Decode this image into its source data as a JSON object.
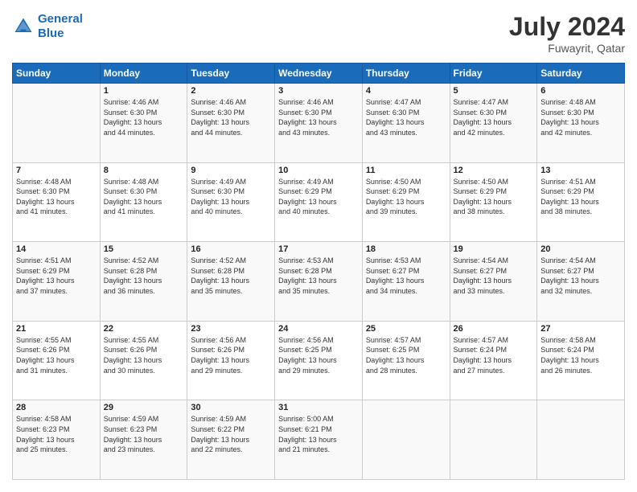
{
  "header": {
    "logo_line1": "General",
    "logo_line2": "Blue",
    "month_year": "July 2024",
    "location": "Fuwayrit, Qatar"
  },
  "days_of_week": [
    "Sunday",
    "Monday",
    "Tuesday",
    "Wednesday",
    "Thursday",
    "Friday",
    "Saturday"
  ],
  "weeks": [
    [
      {
        "day": "",
        "sunrise": "",
        "sunset": "",
        "daylight": ""
      },
      {
        "day": "1",
        "sunrise": "4:46 AM",
        "sunset": "6:30 PM",
        "daylight": "13 hours and 44 minutes."
      },
      {
        "day": "2",
        "sunrise": "4:46 AM",
        "sunset": "6:30 PM",
        "daylight": "13 hours and 44 minutes."
      },
      {
        "day": "3",
        "sunrise": "4:46 AM",
        "sunset": "6:30 PM",
        "daylight": "13 hours and 43 minutes."
      },
      {
        "day": "4",
        "sunrise": "4:47 AM",
        "sunset": "6:30 PM",
        "daylight": "13 hours and 43 minutes."
      },
      {
        "day": "5",
        "sunrise": "4:47 AM",
        "sunset": "6:30 PM",
        "daylight": "13 hours and 42 minutes."
      },
      {
        "day": "6",
        "sunrise": "4:48 AM",
        "sunset": "6:30 PM",
        "daylight": "13 hours and 42 minutes."
      }
    ],
    [
      {
        "day": "7",
        "sunrise": "4:48 AM",
        "sunset": "6:30 PM",
        "daylight": "13 hours and 41 minutes."
      },
      {
        "day": "8",
        "sunrise": "4:48 AM",
        "sunset": "6:30 PM",
        "daylight": "13 hours and 41 minutes."
      },
      {
        "day": "9",
        "sunrise": "4:49 AM",
        "sunset": "6:30 PM",
        "daylight": "13 hours and 40 minutes."
      },
      {
        "day": "10",
        "sunrise": "4:49 AM",
        "sunset": "6:29 PM",
        "daylight": "13 hours and 40 minutes."
      },
      {
        "day": "11",
        "sunrise": "4:50 AM",
        "sunset": "6:29 PM",
        "daylight": "13 hours and 39 minutes."
      },
      {
        "day": "12",
        "sunrise": "4:50 AM",
        "sunset": "6:29 PM",
        "daylight": "13 hours and 38 minutes."
      },
      {
        "day": "13",
        "sunrise": "4:51 AM",
        "sunset": "6:29 PM",
        "daylight": "13 hours and 38 minutes."
      }
    ],
    [
      {
        "day": "14",
        "sunrise": "4:51 AM",
        "sunset": "6:29 PM",
        "daylight": "13 hours and 37 minutes."
      },
      {
        "day": "15",
        "sunrise": "4:52 AM",
        "sunset": "6:28 PM",
        "daylight": "13 hours and 36 minutes."
      },
      {
        "day": "16",
        "sunrise": "4:52 AM",
        "sunset": "6:28 PM",
        "daylight": "13 hours and 35 minutes."
      },
      {
        "day": "17",
        "sunrise": "4:53 AM",
        "sunset": "6:28 PM",
        "daylight": "13 hours and 35 minutes."
      },
      {
        "day": "18",
        "sunrise": "4:53 AM",
        "sunset": "6:27 PM",
        "daylight": "13 hours and 34 minutes."
      },
      {
        "day": "19",
        "sunrise": "4:54 AM",
        "sunset": "6:27 PM",
        "daylight": "13 hours and 33 minutes."
      },
      {
        "day": "20",
        "sunrise": "4:54 AM",
        "sunset": "6:27 PM",
        "daylight": "13 hours and 32 minutes."
      }
    ],
    [
      {
        "day": "21",
        "sunrise": "4:55 AM",
        "sunset": "6:26 PM",
        "daylight": "13 hours and 31 minutes."
      },
      {
        "day": "22",
        "sunrise": "4:55 AM",
        "sunset": "6:26 PM",
        "daylight": "13 hours and 30 minutes."
      },
      {
        "day": "23",
        "sunrise": "4:56 AM",
        "sunset": "6:26 PM",
        "daylight": "13 hours and 29 minutes."
      },
      {
        "day": "24",
        "sunrise": "4:56 AM",
        "sunset": "6:25 PM",
        "daylight": "13 hours and 29 minutes."
      },
      {
        "day": "25",
        "sunrise": "4:57 AM",
        "sunset": "6:25 PM",
        "daylight": "13 hours and 28 minutes."
      },
      {
        "day": "26",
        "sunrise": "4:57 AM",
        "sunset": "6:24 PM",
        "daylight": "13 hours and 27 minutes."
      },
      {
        "day": "27",
        "sunrise": "4:58 AM",
        "sunset": "6:24 PM",
        "daylight": "13 hours and 26 minutes."
      }
    ],
    [
      {
        "day": "28",
        "sunrise": "4:58 AM",
        "sunset": "6:23 PM",
        "daylight": "13 hours and 25 minutes."
      },
      {
        "day": "29",
        "sunrise": "4:59 AM",
        "sunset": "6:23 PM",
        "daylight": "13 hours and 23 minutes."
      },
      {
        "day": "30",
        "sunrise": "4:59 AM",
        "sunset": "6:22 PM",
        "daylight": "13 hours and 22 minutes."
      },
      {
        "day": "31",
        "sunrise": "5:00 AM",
        "sunset": "6:21 PM",
        "daylight": "13 hours and 21 minutes."
      },
      {
        "day": "",
        "sunrise": "",
        "sunset": "",
        "daylight": ""
      },
      {
        "day": "",
        "sunrise": "",
        "sunset": "",
        "daylight": ""
      },
      {
        "day": "",
        "sunrise": "",
        "sunset": "",
        "daylight": ""
      }
    ]
  ],
  "labels": {
    "sunrise_prefix": "Sunrise: ",
    "sunset_prefix": "Sunset: ",
    "daylight_prefix": "Daylight: "
  }
}
